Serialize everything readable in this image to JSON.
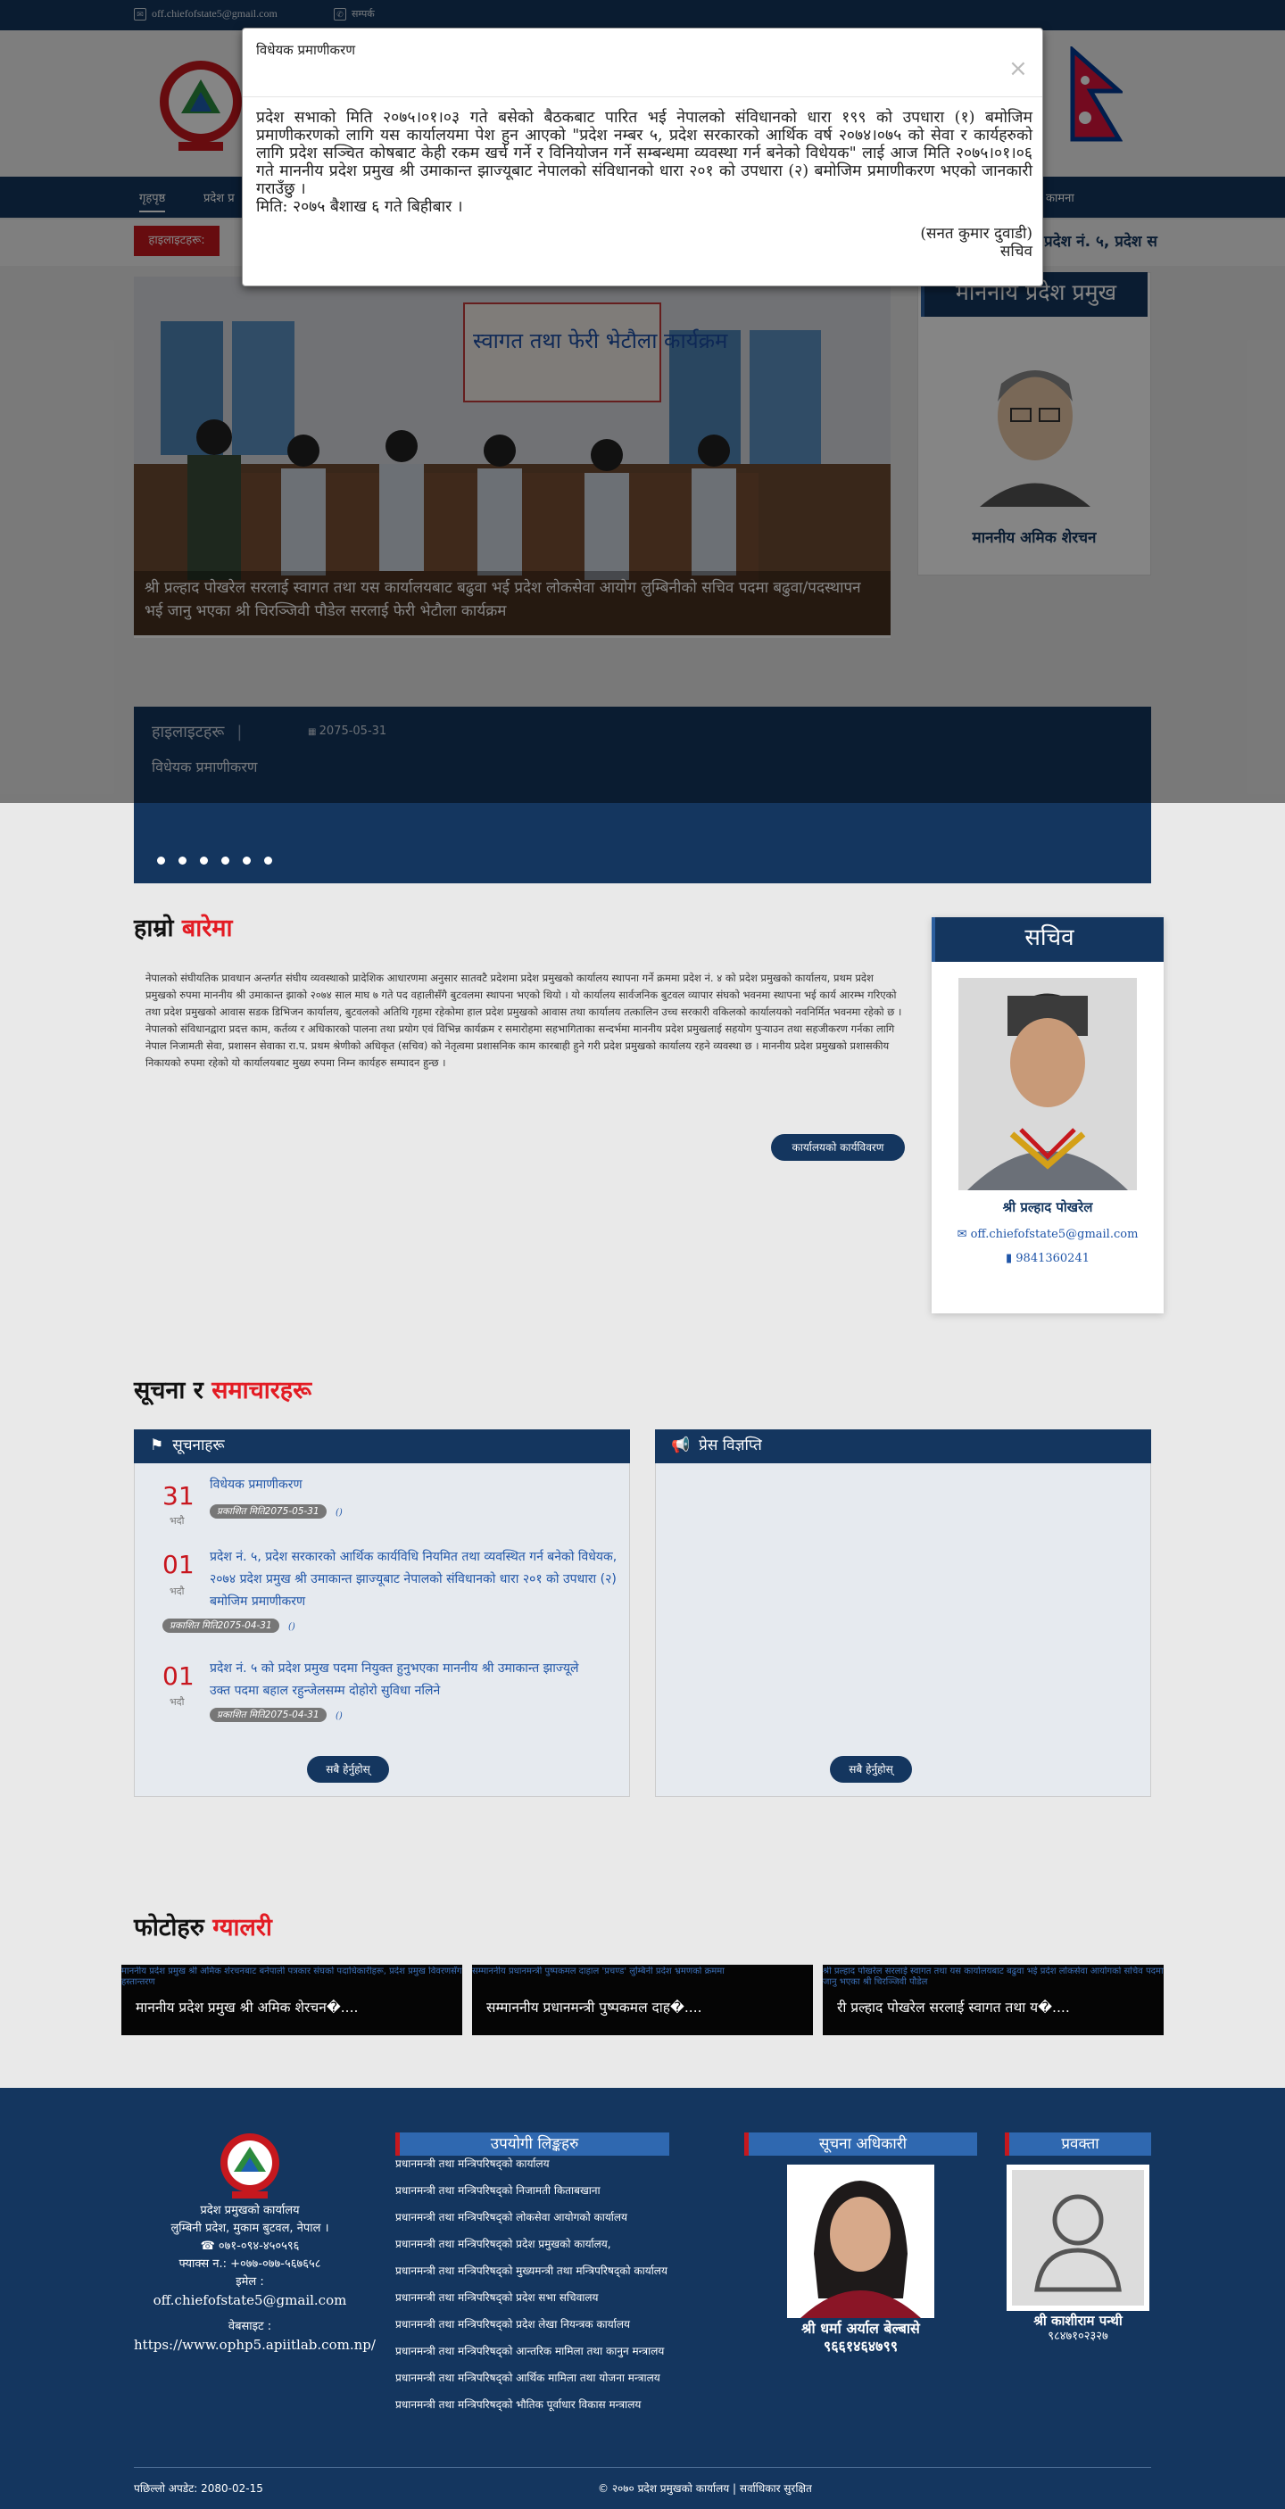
{
  "topbar": {
    "email": "off.chiefofstate5@gmail.com",
    "contact": "सम्पर्क"
  },
  "nav": {
    "items": [
      "गृहपृष्ठ",
      "प्रदेश प्र",
      "कामना"
    ]
  },
  "ticker": {
    "badge": "हाइलाइटहरू:",
    "text": "प्रदेश नं. ५, प्रदेश स"
  },
  "modal": {
    "title": "विधेयक प्रमाणीकरण",
    "close": "×",
    "body": "प्रदेश सभाको मिति २०७५।०१।०३ गते बसेको बैठकबाट पारित भई नेपालको संविधानको धारा १९९ को उपधारा (१) बमोजिम प्रमाणीकरणको लागि यस कार्यालयमा पेश हुन आएको \"प्रदेश नम्बर ५, प्रदेश सरकारको आर्थिक वर्ष २०७४।०७५ को सेवा र कार्यहरुको लागि प्रदेश सञ्चित कोषबाट केही रकम खर्च गर्ने र विनियोजन गर्ने सम्बन्धमा व्यवस्था गर्न बनेको विधेयक\" लाई आज मिति २०७५।०१।०६ गते माननीय प्रदेश प्रमुख श्री उमाकान्त झाज्यूबाट नेपालको संविधानको धारा २०१ को उपधारा (२) बमोजिम प्रमाणीकरण भएको जानकारी गराउँछु ।",
    "date_line": "मिति: २०७५ बैशाख ६ गते बिहीबार ।",
    "sign_name": "(सनत कुमार दुवाडी)",
    "sign_title": "सचिव"
  },
  "slider": {
    "caption": "श्री प्रल्हाद पोखरेल सरलाई स्वागत तथा यस कार्यालयबाट बढुवा भई प्रदेश लोकसेवा आयोग लुम्बिनीको सचिव पदमा बढुवा/पदस्थापन भई जानु भएका श्री चिरञ्जिवी पौडेल सरलाई फेरी भेटौला कार्यक्रम",
    "banner": "स्वागत तथा फेरी भेटौला कार्यक्रम"
  },
  "chief_card": {
    "title": "माननीय प्रदेश प्रमुख",
    "name": "माननीय अमिक शेरचन"
  },
  "highlights": {
    "label": "हाइलाइटहरू",
    "date": "2075-05-31",
    "text": "विधेयक प्रमाणीकरण"
  },
  "about": {
    "title_a": "हाम्रो ",
    "title_b": "बारेमा",
    "p1": "नेपालको संघीयतिक प्रावधान अन्तर्गत संघीय व्यवस्थाको प्रादेशिक आधारणमा अनुसार सातवटै प्रदेशमा प्रदेश प्रमुखको कार्यालय स्थापना गर्ने क्रममा प्रदेश नं. ४ को प्रदेश प्रमुखको कार्यालय, प्रथम प्रदेश प्रमुखको रुपमा माननीय श्री उमाकान्त झाको २०७४ साल माघ ७ गते पद वहालीसँगै बुटवलमा स्थापना भएको थियो । यो कार्यालय सार्वजनिक बुटवल व्यापार संघको भवनमा स्थापना भई कार्य आरम्भ गरिएको तथा प्रदेश प्रमुखको आवास सडक डिभिजन कार्यालय, बुटवलको अतिथि गृहमा रहेकोमा हाल प्रदेश प्रमुखको आवास तथा कार्यालय तत्कालिन उच्च सरकारी वकिलको कार्यालयको नवनिर्मित भवनमा रहेको छ ।",
    "p2": "नेपालको संविधानद्वारा प्रदत्त काम, कर्तव्य र अधिकारको पालना तथा प्रयोग एवं विभिन्न कार्यक्रम र समारोहमा सहभागिताका सन्दर्भमा माननीय प्रदेश प्रमुखलाई सहयोग पुऱ्याउन तथा सहजीकरण गर्नका लागि नेपाल निजामती सेवा, प्रशासन सेवाका रा.प. प्रथम श्रेणीको अधिकृत (सचिव) को नेतृत्वमा प्रशासनिक काम कारबाही हुने गरी प्रदेश प्रमुखको कार्यालय रहने व्यवस्था छ । माननीय प्रदेश प्रमुखको प्रशासकीय निकायको रुपमा रहेको यो कार्यालयबाट मुख्य रुपमा निम्न कार्यहरु सम्पादन हुन्छ ।",
    "button": "कार्यालयको कार्यविवरण"
  },
  "secretary": {
    "title": "सचिव",
    "name": "श्री प्रल्हाद पोखरेल",
    "email": "off.chiefofstate5@gmail.com",
    "phone": "9841360241"
  },
  "news": {
    "title_a": "सूचना र ",
    "title_b": "समाचारहरू",
    "notices_title": "सूचनाहरू",
    "press_title": "प्रेस विज्ञप्ति",
    "items": [
      {
        "day": "31",
        "month": "भदौ",
        "text": "विधेयक प्रमाणीकरण",
        "published": "प्रकाशित मिति2075-05-31",
        "mark": "()"
      },
      {
        "day": "01",
        "month": "भदौ",
        "text": "प्रदेश नं. ५, प्रदेश सरकारको आर्थिक कार्यविधि नियमित तथा व्यवस्थित गर्न बनेको विधेयक, २०७४ प्रदेश प्रमुख श्री उमाकान्त झाज्यूबाट नेपालको संविधानको धारा २०१ को उपधारा (२) बमोजिम प्रमाणीकरण",
        "published": "प्रकाशित मिति2075-04-31",
        "mark": "()"
      },
      {
        "day": "01",
        "month": "भदौ",
        "text": "प्रदेश नं. ५ को प्रदेश प्रमुख पदमा नियुक्त हुनुभएका माननीय श्री उमाकान्त झाज्यूले उक्त पदमा बहाल रहुन्जेलसम्म दोहोरो सुविधा नलिने",
        "published": "प्रकाशित मिति2075-04-31",
        "mark": "()"
      }
    ],
    "all_button": "सबै हेर्नुहोस्"
  },
  "gallery": {
    "title_a": "फोटोहरु ",
    "title_b": "ग्यालरी",
    "items": [
      {
        "alt": "माननीय प्रदेश प्रमुख श्री अमिक शेरचनबाट बनेपाली पत्रकार संघको पदाधिकारीहरू, प्रदेश प्रमुख विवरणसँग हस्तान्तरण",
        "caption": "माननीय प्रदेश प्रमुख श्री अमिक शेरचन�...."
      },
      {
        "alt": "सम्माननीय प्रधानमन्त्री पुष्पकमल दाहाल 'प्रचण्ड' लुम्बिनी प्रदेश भ्रमणको क्रममा",
        "caption": "सम्माननीय प्रधानमन्त्री पुष्पकमल दाह�...."
      },
      {
        "alt": "श्री प्रल्हाद पोखरेल सरलाई स्वागत तथा यस कार्यालयबाट बढुवा भई प्रदेश लोकसेवा आयोगको सचिव पदमा जानु भएका श्री चिरञ्जिवी पौडेल",
        "caption": "री प्रल्हाद पोखरेल सरलाई स्वागत तथा य�...."
      }
    ]
  },
  "footer": {
    "org": "प्रदेश प्रमुखको कार्यालय",
    "address": "लुम्बिनी प्रदेश, मुकाम बुटवल, नेपाल ।",
    "phone": "☎ ०७१-०९४-४५०५९६",
    "fax": "फ्याक्स न.: +०७७-०७७-५६७६५८",
    "email_label": "इमेल :",
    "email": "off.chiefofstate5@gmail.com",
    "website_label": "वेबसाइट :",
    "website": "https://www.ophp5.apiitlab.com.np/",
    "links_title": "उपयोगी लिङ्कहरु",
    "links": [
      "प्रधानमन्त्री तथा मन्त्रिपरिषद्को कार्यालय",
      "प्रधानमन्त्री तथा मन्त्रिपरिषद्को निजामती किताबखाना",
      "प्रधानमन्त्री तथा मन्त्रिपरिषद्को लोकसेवा आयोगको कार्यालय",
      "प्रधानमन्त्री तथा मन्त्रिपरिषद्को प्रदेश प्रमुखको कार्यालय,",
      "प्रधानमन्त्री तथा मन्त्रिपरिषद्को मुख्यमन्त्री तथा मन्त्रिपरिषद्को कार्यालय",
      "प्रधानमन्त्री तथा मन्त्रिपरिषद्को प्रदेश सभा सचिवालय",
      "प्रधानमन्त्री तथा मन्त्रिपरिषद्को प्रदेश लेखा नियन्त्रक कार्यालय",
      "प्रधानमन्त्री तथा मन्त्रिपरिषद्को आन्तरिक मामिला तथा कानुन मन्त्रालय",
      "प्रधानमन्त्री तथा मन्त्रिपरिषद्को आर्थिक मामिला तथा योजना मन्त्रालय",
      "प्रधानमन्त्री तथा मन्त्रिपरिषद्को भौतिक पूर्वाधार विकास मन्त्रालय"
    ],
    "info_title": "सूचना अधिकारी",
    "info_name": "श्री धर्मा अर्याल बेल्बासे",
    "info_phone": "९६६१४६४७९९",
    "spokes_title": "प्रवक्ता",
    "spokes_name": "श्री काशीराम पन्थी",
    "spokes_phone": "९८४७१०२३२७",
    "updated": "पछिल्लो अपडेट: 2080-02-15",
    "copyright": "© २०७० प्रदेश प्रमुखको कार्यालय | सर्वाधिकार सुरक्षित"
  }
}
